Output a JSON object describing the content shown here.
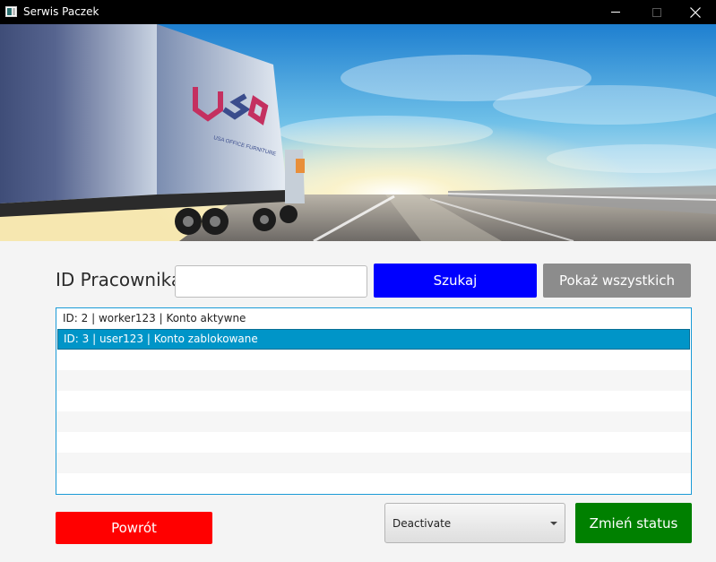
{
  "window": {
    "title": "Serwis Paczek"
  },
  "search": {
    "label": "ID Pracownika:",
    "input_value": "",
    "input_placeholder": "",
    "search_button": "Szukaj",
    "show_all_button": "Pokaż wszystkich"
  },
  "list": {
    "items": [
      {
        "label": "ID: 2  |  worker123  |  Konto aktywne",
        "selected": false
      },
      {
        "label": "ID: 3  |  user123  |  Konto zablokowane",
        "selected": true
      }
    ]
  },
  "actions": {
    "back_button": "Powrót",
    "status_select_value": "Deactivate",
    "change_status_button": "Zmień status"
  },
  "colors": {
    "search_button": "#0000ff",
    "show_all_button": "#8c8c8c",
    "back_button": "#ff0000",
    "change_status_button": "#008000",
    "list_selection": "#0095c8"
  }
}
